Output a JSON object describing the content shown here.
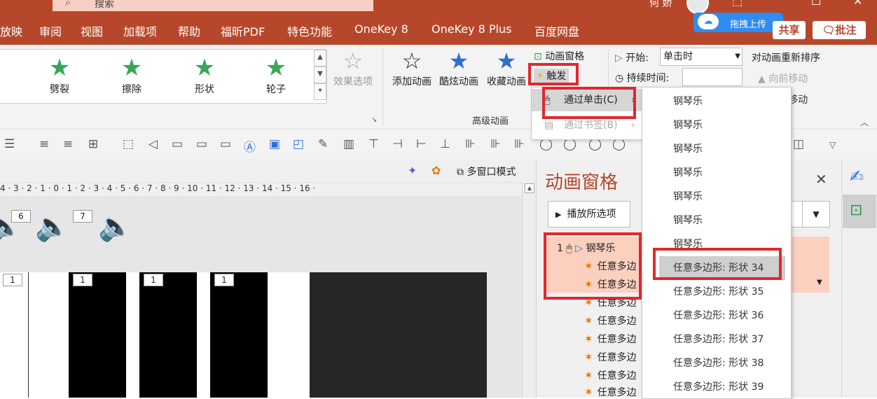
{
  "titlebar": {
    "search_icon": "search-icon",
    "search_text": "搜索",
    "user_name": "何 娇",
    "restore_glyph": "⬚",
    "max_glyph": "☐",
    "close_glyph": "✕"
  },
  "tabs": [
    "放映",
    "审阅",
    "视图",
    "加载项",
    "帮助",
    "福昕PDF",
    "特色功能",
    "OneKey 8",
    "OneKey 8 Plus",
    "百度网盘"
  ],
  "upload": {
    "label": "拖拽上传"
  },
  "share": {
    "label": "共享"
  },
  "comment": {
    "label": "批注"
  },
  "ribbon": {
    "effects": [
      "劈裂",
      "擦除",
      "形状",
      "轮子"
    ],
    "effect_options": "效果选项",
    "add_animation": "添加动画",
    "cool_animation": "酷炫动画",
    "fav_animation": "收藏动画",
    "group_advanced": "高级动画",
    "anim_pane": "动画窗格",
    "trigger": "触发",
    "start_label": "开始:",
    "start_value": "单击时",
    "duration_label": "持续时间:",
    "reorder_label": "对动画重新排序",
    "move_earlier": "向前移动",
    "move_later": "向后移动"
  },
  "submenu": {
    "on_click": "通过单击(C)",
    "on_bookmark": "通过书签(B)"
  },
  "dropdown": {
    "items": [
      "钢琴乐",
      "钢琴乐",
      "钢琴乐",
      "钢琴乐",
      "钢琴乐",
      "钢琴乐",
      "钢琴乐",
      "任意多边形: 形状 34",
      "任意多边形: 形状 35",
      "任意多边形: 形状 36",
      "任意多边形: 形状 37",
      "任意多边形: 形状 38",
      "任意多边形: 形状 39"
    ],
    "selected_index": 7
  },
  "editor": {
    "multiwindow": "多窗口模式",
    "ruler": "4 · 3 · 2 · 1 · 0 · 1 · 2 · 3 · 4 · 5 · 6 · 7 · 8 · 9 · 10 · 11 · 12 · 13 · 14 · 15 · 16 ·",
    "speaker_tags": [
      "6",
      "7"
    ],
    "key_tags": [
      "1",
      "1",
      "1",
      "1"
    ]
  },
  "animpane": {
    "title": "动画窗格",
    "play_selected": "播放所选项",
    "first_num": "1",
    "first_item": "钢琴乐",
    "shape_item": "任意多边形",
    "shape_prefix": "任意多边"
  }
}
